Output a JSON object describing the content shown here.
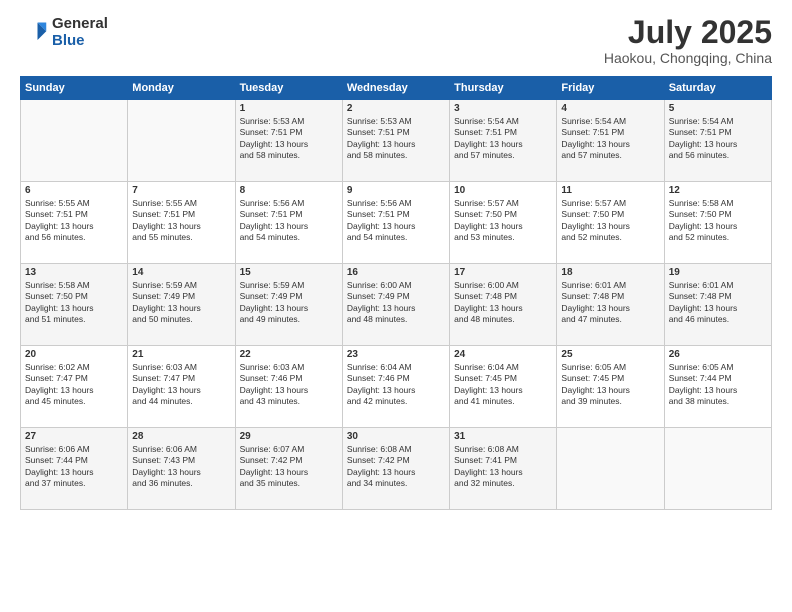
{
  "header": {
    "logo_general": "General",
    "logo_blue": "Blue",
    "month_title": "July 2025",
    "location": "Haokou, Chongqing, China"
  },
  "days_of_week": [
    "Sunday",
    "Monday",
    "Tuesday",
    "Wednesday",
    "Thursday",
    "Friday",
    "Saturday"
  ],
  "weeks": [
    [
      {
        "day": "",
        "info": ""
      },
      {
        "day": "",
        "info": ""
      },
      {
        "day": "1",
        "info": "Sunrise: 5:53 AM\nSunset: 7:51 PM\nDaylight: 13 hours\nand 58 minutes."
      },
      {
        "day": "2",
        "info": "Sunrise: 5:53 AM\nSunset: 7:51 PM\nDaylight: 13 hours\nand 58 minutes."
      },
      {
        "day": "3",
        "info": "Sunrise: 5:54 AM\nSunset: 7:51 PM\nDaylight: 13 hours\nand 57 minutes."
      },
      {
        "day": "4",
        "info": "Sunrise: 5:54 AM\nSunset: 7:51 PM\nDaylight: 13 hours\nand 57 minutes."
      },
      {
        "day": "5",
        "info": "Sunrise: 5:54 AM\nSunset: 7:51 PM\nDaylight: 13 hours\nand 56 minutes."
      }
    ],
    [
      {
        "day": "6",
        "info": "Sunrise: 5:55 AM\nSunset: 7:51 PM\nDaylight: 13 hours\nand 56 minutes."
      },
      {
        "day": "7",
        "info": "Sunrise: 5:55 AM\nSunset: 7:51 PM\nDaylight: 13 hours\nand 55 minutes."
      },
      {
        "day": "8",
        "info": "Sunrise: 5:56 AM\nSunset: 7:51 PM\nDaylight: 13 hours\nand 54 minutes."
      },
      {
        "day": "9",
        "info": "Sunrise: 5:56 AM\nSunset: 7:51 PM\nDaylight: 13 hours\nand 54 minutes."
      },
      {
        "day": "10",
        "info": "Sunrise: 5:57 AM\nSunset: 7:50 PM\nDaylight: 13 hours\nand 53 minutes."
      },
      {
        "day": "11",
        "info": "Sunrise: 5:57 AM\nSunset: 7:50 PM\nDaylight: 13 hours\nand 52 minutes."
      },
      {
        "day": "12",
        "info": "Sunrise: 5:58 AM\nSunset: 7:50 PM\nDaylight: 13 hours\nand 52 minutes."
      }
    ],
    [
      {
        "day": "13",
        "info": "Sunrise: 5:58 AM\nSunset: 7:50 PM\nDaylight: 13 hours\nand 51 minutes."
      },
      {
        "day": "14",
        "info": "Sunrise: 5:59 AM\nSunset: 7:49 PM\nDaylight: 13 hours\nand 50 minutes."
      },
      {
        "day": "15",
        "info": "Sunrise: 5:59 AM\nSunset: 7:49 PM\nDaylight: 13 hours\nand 49 minutes."
      },
      {
        "day": "16",
        "info": "Sunrise: 6:00 AM\nSunset: 7:49 PM\nDaylight: 13 hours\nand 48 minutes."
      },
      {
        "day": "17",
        "info": "Sunrise: 6:00 AM\nSunset: 7:48 PM\nDaylight: 13 hours\nand 48 minutes."
      },
      {
        "day": "18",
        "info": "Sunrise: 6:01 AM\nSunset: 7:48 PM\nDaylight: 13 hours\nand 47 minutes."
      },
      {
        "day": "19",
        "info": "Sunrise: 6:01 AM\nSunset: 7:48 PM\nDaylight: 13 hours\nand 46 minutes."
      }
    ],
    [
      {
        "day": "20",
        "info": "Sunrise: 6:02 AM\nSunset: 7:47 PM\nDaylight: 13 hours\nand 45 minutes."
      },
      {
        "day": "21",
        "info": "Sunrise: 6:03 AM\nSunset: 7:47 PM\nDaylight: 13 hours\nand 44 minutes."
      },
      {
        "day": "22",
        "info": "Sunrise: 6:03 AM\nSunset: 7:46 PM\nDaylight: 13 hours\nand 43 minutes."
      },
      {
        "day": "23",
        "info": "Sunrise: 6:04 AM\nSunset: 7:46 PM\nDaylight: 13 hours\nand 42 minutes."
      },
      {
        "day": "24",
        "info": "Sunrise: 6:04 AM\nSunset: 7:45 PM\nDaylight: 13 hours\nand 41 minutes."
      },
      {
        "day": "25",
        "info": "Sunrise: 6:05 AM\nSunset: 7:45 PM\nDaylight: 13 hours\nand 39 minutes."
      },
      {
        "day": "26",
        "info": "Sunrise: 6:05 AM\nSunset: 7:44 PM\nDaylight: 13 hours\nand 38 minutes."
      }
    ],
    [
      {
        "day": "27",
        "info": "Sunrise: 6:06 AM\nSunset: 7:44 PM\nDaylight: 13 hours\nand 37 minutes."
      },
      {
        "day": "28",
        "info": "Sunrise: 6:06 AM\nSunset: 7:43 PM\nDaylight: 13 hours\nand 36 minutes."
      },
      {
        "day": "29",
        "info": "Sunrise: 6:07 AM\nSunset: 7:42 PM\nDaylight: 13 hours\nand 35 minutes."
      },
      {
        "day": "30",
        "info": "Sunrise: 6:08 AM\nSunset: 7:42 PM\nDaylight: 13 hours\nand 34 minutes."
      },
      {
        "day": "31",
        "info": "Sunrise: 6:08 AM\nSunset: 7:41 PM\nDaylight: 13 hours\nand 32 minutes."
      },
      {
        "day": "",
        "info": ""
      },
      {
        "day": "",
        "info": ""
      }
    ]
  ]
}
